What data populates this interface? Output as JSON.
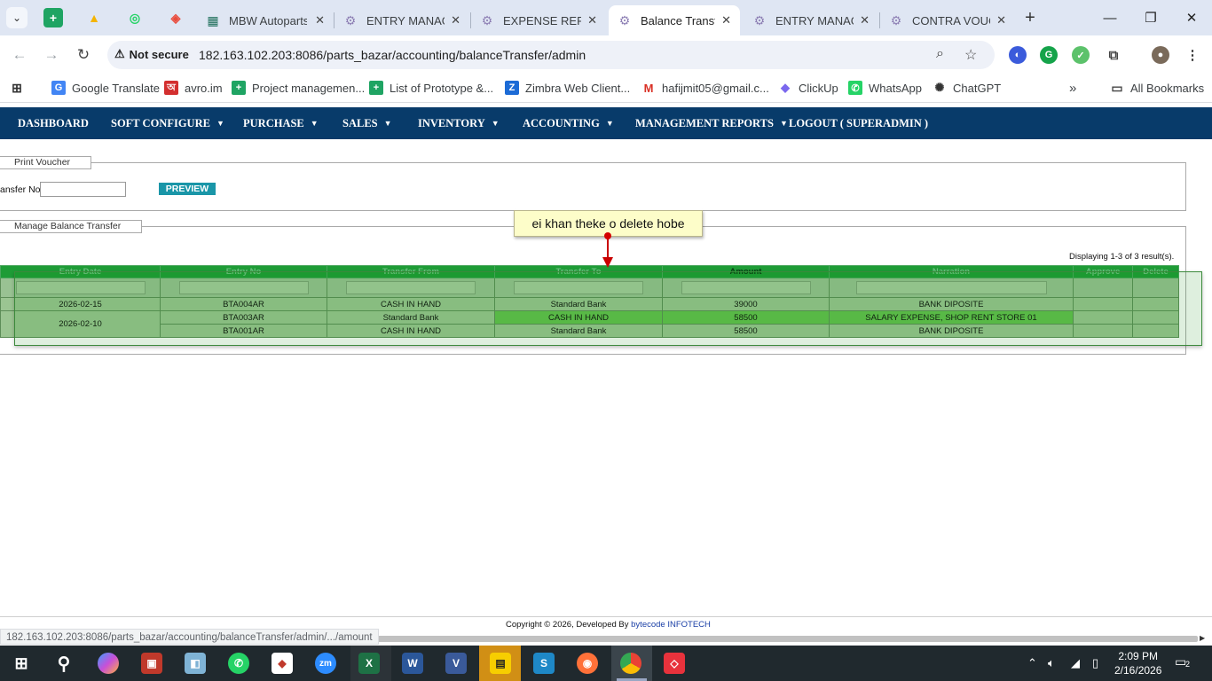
{
  "browser": {
    "tabs": [
      {
        "label": "MBW Autoparts",
        "icon": "mbw-favicon"
      },
      {
        "label": "ENTRY MANAG",
        "icon": "gear-favicon"
      },
      {
        "label": "EXPENSE REPORT",
        "icon": "gear-favicon"
      },
      {
        "label": "Balance Transfer",
        "icon": "gear-favicon",
        "active": true
      },
      {
        "label": "ENTRY MANAG",
        "icon": "gear-favicon"
      },
      {
        "label": "CONTRA VOUCHER",
        "icon": "gear-favicon"
      }
    ],
    "security_label": "Not secure",
    "url": "182.163.102.203:8086/parts_bazar/accounting/balanceTransfer/admin",
    "bookmarks": [
      "Google Translate",
      "avro.im",
      "Project managemen...",
      "List of Prototype &...",
      "Zimbra Web Client...",
      "hafijmit05@gmail.c...",
      "ClickUp",
      "WhatsApp",
      "ChatGPT"
    ],
    "all_bookmarks": "All Bookmarks",
    "status_url": "182.163.102.203:8086/parts_bazar/accounting/balanceTransfer/admin/.../amount"
  },
  "nav": {
    "items": [
      {
        "label": "DASHBOARD",
        "caret": false
      },
      {
        "label": "SOFT CONFIGURE",
        "caret": true
      },
      {
        "label": "PURCHASE",
        "caret": true
      },
      {
        "label": "SALES",
        "caret": true
      },
      {
        "label": "INVENTORY",
        "caret": true
      },
      {
        "label": "ACCOUNTING",
        "caret": true
      },
      {
        "label": "MANAGEMENT REPORTS",
        "caret": true
      },
      {
        "label": "LOGOUT ( SUPERADMIN )",
        "caret": false
      }
    ]
  },
  "print_voucher": {
    "legend": "Print Voucher",
    "field_label": "ansfer No",
    "input_value": "",
    "button": "PREVIEW"
  },
  "manage": {
    "legend": "Manage Balance Transfer",
    "displaying": "Displaying 1-3 of 3 result(s).",
    "columns": [
      "Entry Date",
      "Entry No",
      "Transfer From",
      "Transfer To",
      "Amount",
      "Narration",
      "Approve",
      "Delete"
    ],
    "rows": [
      {
        "date": "2026-02-15",
        "entry_no": "BTA004AR",
        "from": "CASH IN HAND",
        "to": "Standard Bank",
        "amount": "39000",
        "narration": "BANK DIPOSITE"
      },
      {
        "date": "2026-02-10",
        "entry_no": "BTA003AR",
        "from": "Standard Bank",
        "to": "CASH IN HAND",
        "amount": "58500",
        "narration": "SALARY EXPENSE, SHOP RENT STORE 01"
      },
      {
        "date": "",
        "entry_no": "BTA001AR",
        "from": "CASH IN HAND",
        "to": "Standard Bank",
        "amount": "58500",
        "narration": "BANK DIPOSITE"
      }
    ]
  },
  "annotation": {
    "text": "ei khan theke o delete hobe"
  },
  "footer": {
    "prefix": "Copyright © 2026, Developed By ",
    "brand": "bytecode INFOTECH"
  },
  "taskbar": {
    "time": "2:09 PM",
    "date": "2/16/2026",
    "notifications": "2"
  },
  "colors": {
    "nav_bg": "#083b6a",
    "table_header": "#1e9c36",
    "table_row": "#9bc592",
    "highlight_row": "#63c04e",
    "preview_button": "#1a96a8"
  }
}
